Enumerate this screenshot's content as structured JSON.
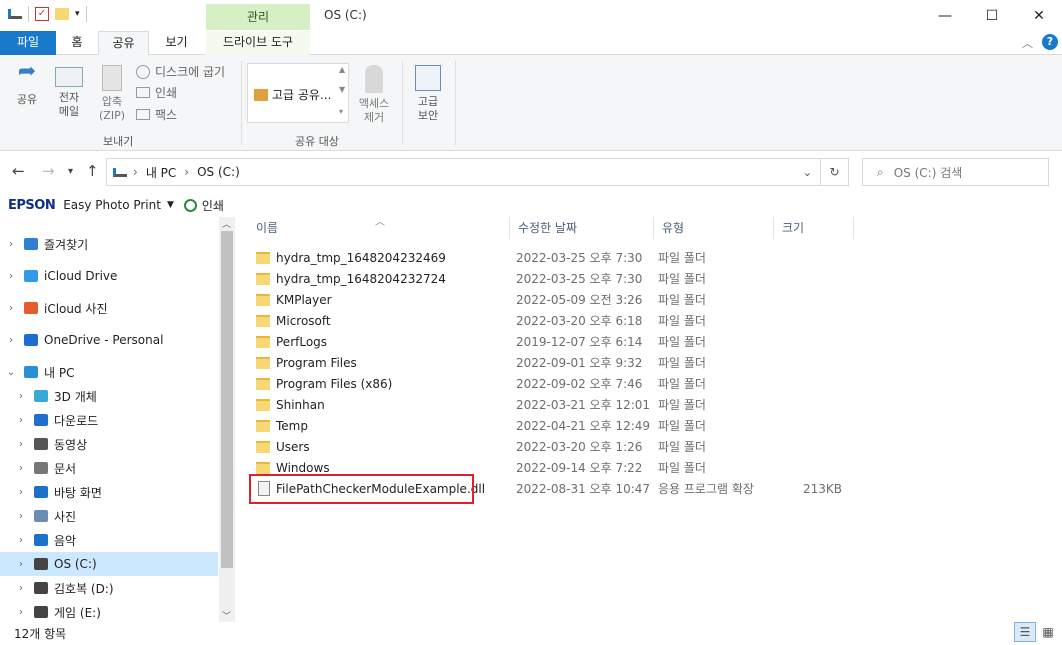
{
  "window": {
    "title": "OS (C:)",
    "context_tab": "관리",
    "minimize": "—",
    "maximize": "☐",
    "close": "✕"
  },
  "ribbon_tabs": [
    "파일",
    "홈",
    "공유",
    "보기",
    "드라이브 도구"
  ],
  "ribbon": {
    "share": "공유",
    "email": "전자\n메일",
    "zip": "압축\n(ZIP)",
    "burn": "디스크에 굽기",
    "print": "인쇄",
    "fax": "팩스",
    "send_group": "보내기",
    "advanced_share": "고급 공유...",
    "remove_access": "액세스\n제거",
    "share_with_group": "공유 대상",
    "advanced_security": "고급\n보안"
  },
  "address": {
    "crumbs": [
      "내 PC",
      "OS (C:)"
    ],
    "search_placeholder": "OS (C:) 검색"
  },
  "epson_bar": {
    "brand": "EPSON",
    "app": "Easy Photo Print",
    "print": "인쇄"
  },
  "nav_pane": [
    {
      "label": "즐겨찾기",
      "icon": "star-icon",
      "color": "#2f7fd3"
    },
    {
      "label": "iCloud Drive",
      "icon": "icloud-icon",
      "color": "#2f9be6"
    },
    {
      "label": "iCloud 사진",
      "icon": "icloud-photos-icon",
      "color": "#e55c2f"
    },
    {
      "label": "OneDrive - Personal",
      "icon": "onedrive-icon",
      "color": "#1c6fd1"
    },
    {
      "label": "내 PC",
      "icon": "computer-icon",
      "color": "#2b8fd8"
    },
    {
      "label": "3D 개체",
      "icon": "3d-objects-icon",
      "color": "#36a9d6"
    },
    {
      "label": "다운로드",
      "icon": "download-icon",
      "color": "#1f6fd0"
    },
    {
      "label": "동영상",
      "icon": "video-icon",
      "color": "#555555"
    },
    {
      "label": "문서",
      "icon": "document-icon",
      "color": "#777777"
    },
    {
      "label": "바탕 화면",
      "icon": "desktop-icon",
      "color": "#1a73c9"
    },
    {
      "label": "사진",
      "icon": "pictures-icon",
      "color": "#6a8db0"
    },
    {
      "label": "음악",
      "icon": "music-icon",
      "color": "#1a73c9"
    },
    {
      "label": "OS (C:)",
      "icon": "drive-c-icon",
      "color": "#444444"
    },
    {
      "label": "김호복 (D:)",
      "icon": "drive-d-icon",
      "color": "#444444"
    },
    {
      "label": "게임 (E:)",
      "icon": "drive-e-icon",
      "color": "#444444"
    }
  ],
  "columns": [
    "이름",
    "수정한 날짜",
    "유형",
    "크기"
  ],
  "files": [
    {
      "name": "hydra_tmp_1648204232469",
      "date": "2022-03-25 오후 7:30",
      "type": "파일 폴더",
      "size": ""
    },
    {
      "name": "hydra_tmp_1648204232724",
      "date": "2022-03-25 오후 7:30",
      "type": "파일 폴더",
      "size": ""
    },
    {
      "name": "KMPlayer",
      "date": "2022-05-09 오전 3:26",
      "type": "파일 폴더",
      "size": ""
    },
    {
      "name": "Microsoft",
      "date": "2022-03-20 오후 6:18",
      "type": "파일 폴더",
      "size": ""
    },
    {
      "name": "PerfLogs",
      "date": "2019-12-07 오후 6:14",
      "type": "파일 폴더",
      "size": ""
    },
    {
      "name": "Program Files",
      "date": "2022-09-01 오후 9:32",
      "type": "파일 폴더",
      "size": ""
    },
    {
      "name": "Program Files (x86)",
      "date": "2022-09-02 오후 7:46",
      "type": "파일 폴더",
      "size": ""
    },
    {
      "name": "Shinhan",
      "date": "2022-03-21 오후 12:01",
      "type": "파일 폴더",
      "size": ""
    },
    {
      "name": "Temp",
      "date": "2022-04-21 오후 12:49",
      "type": "파일 폴더",
      "size": ""
    },
    {
      "name": "Users",
      "date": "2022-03-20 오후 1:26",
      "type": "파일 폴더",
      "size": ""
    },
    {
      "name": "Windows",
      "date": "2022-09-14 오후 7:22",
      "type": "파일 폴더",
      "size": ""
    },
    {
      "name": "FilePathCheckerModuleExample.dll",
      "date": "2022-08-31 오후 10:47",
      "type": "응용 프로그램 확장",
      "size": "213KB"
    }
  ],
  "status": {
    "item_count": "12개 항목"
  },
  "colors": {
    "file_tab": "#1979ca",
    "manage_tab": "#d7efc4",
    "selection": "#cce8ff",
    "highlight_box": "#d9232d"
  }
}
